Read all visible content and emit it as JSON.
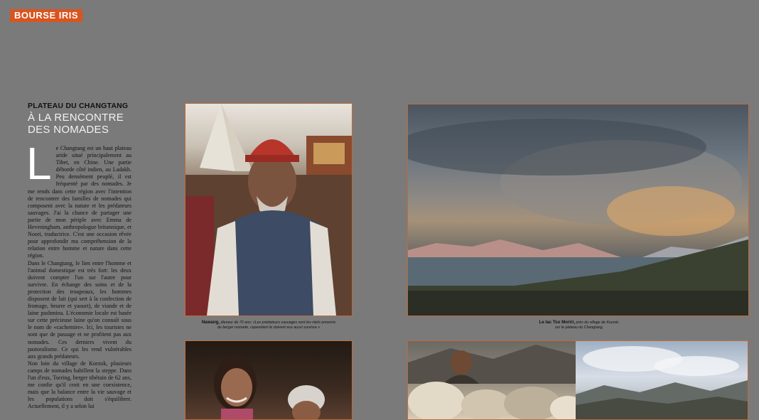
{
  "section_badge": "BOURSE IRIS",
  "article": {
    "kicker": "PLATEAU DU CHANGTANG",
    "headline_line1": "À LA RENCONTRE",
    "headline_line2": "DES NOMADES",
    "dropcap": "L",
    "paragraphs": [
      "e Changtang est un haut plateau aride situé principalement au Tibet, en Chine. Une partie déborde côté indien, au Ladakh. Peu densément peuplé, il est fréquenté par des nomades. Je me rends dans cette région avec l'intention de rencontrer des familles de nomades qui composent avec la nature et les prédateurs sauvages. J'ai la chance de partager une partie de mon périple avec Emma de Heveningham, anthropologue britannique, et Noori, traductrice. C'est une occasion rêvée pour approfondir ma compréhension de la relation entre homme et nature dans cette région.",
      "Dans le Changtang, le lien entre l'homme et l'animal domestique est très fort: les deux doivent compter l'un sur l'autre pour survivre. En échange des soins et de la protection des troupeaux, les hommes disposent de lait (qui sert à la confection de fromage, beurre et yaourt), de viande et de laine pashmina. L'économie locale est basée sur cette précieuse laine qu'on connaît sous le nom de «cachemire». Ici, les touristes ne sont que de passage et ne profitent pas aux nomades. Ces derniers vivent du pastoralisme. Ce qui les rend vulnérables aux grands prédateurs.",
      "Non loin du village de Korzok, plusieurs camps de nomades habillent la steppe. Dans l'un d'eux, Tsering, berger tibétain de 62 ans, me confie qu'il croit en une coexistence, mais que la balance entre la vie sauvage et les populations doit s'équilibrer. Actuellement, il y a selon lui"
    ]
  },
  "photos": [
    {
      "id": "p1",
      "icon": "photo-old-herder"
    },
    {
      "id": "p2",
      "icon": "photo-lake-tso-moriri"
    },
    {
      "id": "p3",
      "icon": "photo-children"
    },
    {
      "id": "p4",
      "icon": "photo-herder-goats"
    },
    {
      "id": "p5",
      "icon": "photo-mountain-sky"
    }
  ],
  "captions": {
    "p1_name": "Nawang,",
    "p1_text_line1": " éleveur de 70 ans: «Les prédateurs sauvages sont les réels ennemis",
    "p1_text_line2": "du berger nomade, cependant ils doivent eux aussi survivre.»",
    "p2_name": "Le lac Tso Moriri,",
    "p2_text_line1": " près du village de Korzok,",
    "p2_text_line2": "sur le plateau du Changtang."
  },
  "colors": {
    "background": "#7a7a7a",
    "accent": "#d9541e",
    "headline": "#f2f2f2",
    "photo_border": "#c06a3a"
  }
}
